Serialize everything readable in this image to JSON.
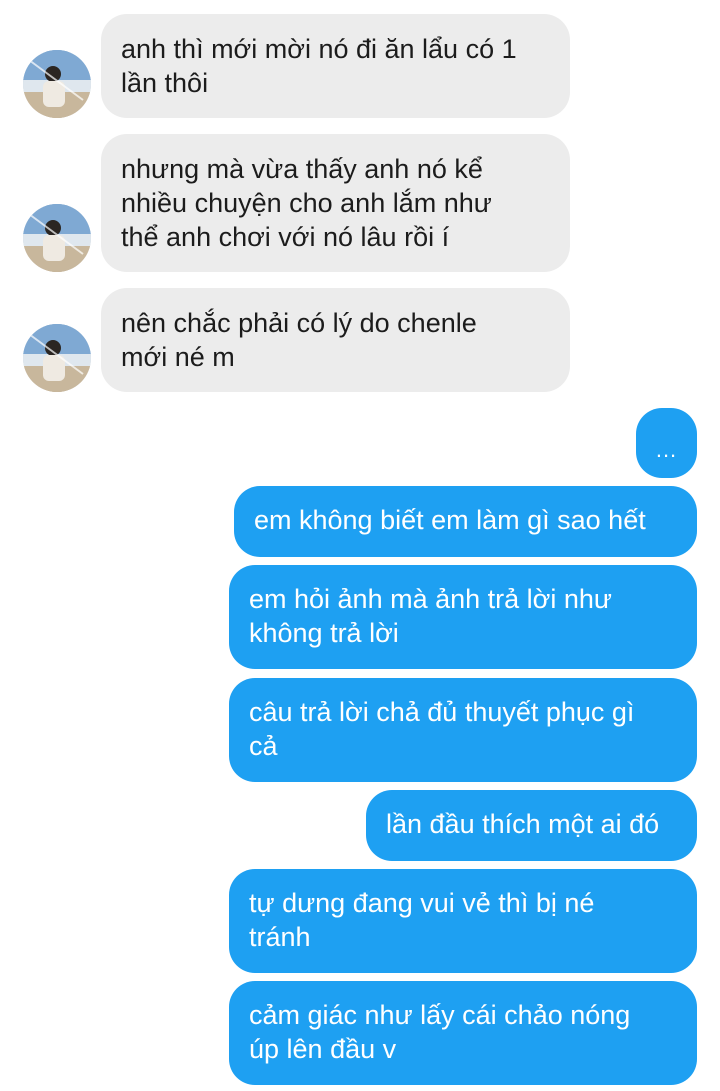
{
  "incoming_messages": [
    {
      "text": "anh thì mới mời nó đi ăn lẩu có 1\nlần thôi"
    },
    {
      "text": "nhưng mà vừa thấy anh nó kể\nnhiều chuyện cho anh lắm như\nthể anh chơi với nó lâu rồi í"
    },
    {
      "text": "nên chắc phải có lý do chenle\nmới né m"
    }
  ],
  "outgoing_messages": [
    {
      "text": "..."
    },
    {
      "text": "em không biết em làm gì sao hết"
    },
    {
      "text": "em hỏi ảnh mà ảnh trả lời như\nkhông trả lời"
    },
    {
      "text": "câu trả lời chả đủ thuyết phục gì\ncả"
    },
    {
      "text": "lần đầu thích một ai đó"
    },
    {
      "text": "tự dưng đang vui vẻ thì bị né\ntránh"
    },
    {
      "text": "cảm giác như lấy cái chảo nóng\núp lên đầu v"
    }
  ],
  "colors": {
    "incoming_bubble": "#ececec",
    "outgoing_bubble": "#1ea0f2",
    "background": "#ffffff"
  },
  "icons": {
    "avatar": "contact-avatar-photo"
  }
}
